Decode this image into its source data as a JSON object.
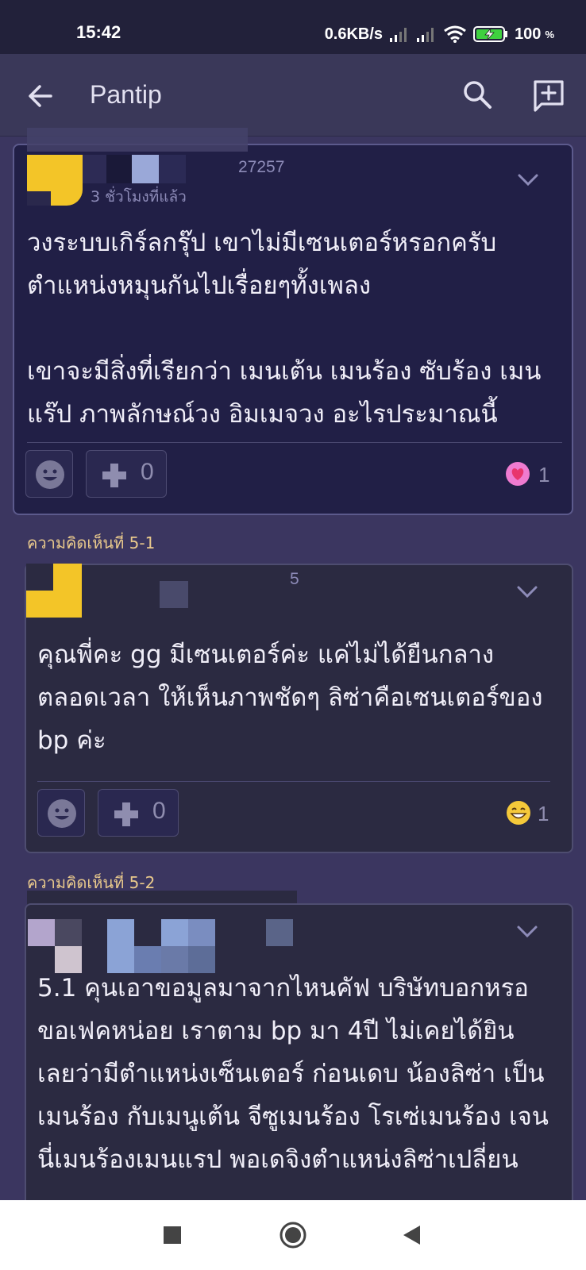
{
  "status_bar": {
    "time": "15:42",
    "network_speed": "0.6KB/s",
    "battery_percent": "100",
    "battery_unit": "%"
  },
  "app_bar": {
    "title": "Pantip",
    "icons": [
      "back-arrow-icon",
      "search-icon",
      "compose-icon"
    ]
  },
  "comments": [
    {
      "user_id_fragment": "27257",
      "time_ago": "3 ชั่วโมงที่แล้ว",
      "body": "วงระบบเกิร์ลกรุ๊ป เขาไม่มีเซนเตอร์หรอกครับ\nตำแหน่งหมุนกันไปเรื่อยๆทั้งเพลง\n\nเขาจะมีสิ่งที่เรียกว่า เมนเต้น เมนร้อง ซับร้อง เมน\nแร๊ป ภาพลักษณ์วง อิมเมจวง อะไรประมาณนี้",
      "plus_count": "0",
      "reaction_icon": "heart-face-icon",
      "reaction_count": "1"
    },
    {
      "label": "ความคิดเห็นที่ 5-1",
      "user_id_fragment": "5",
      "body": "คุณพี่คะ gg มีเซนเตอร์ค่ะ แค่ไม่ได้ยืนกลาง\nตลอดเวลา ให้เห็นภาพชัดๆ ลิซ่าคือเซนเตอร์ของ\nbp ค่ะ",
      "plus_count": "0",
      "reaction_icon": "grin-icon",
      "reaction_count": "1"
    },
    {
      "label": "ความคิดเห็นที่ 5-2",
      "body": "5.1 คุนเอาขอมูลมาจากไหนคัฟ บริษัทบอกหรอ\nขอเฟคหน่อย เราตาม bp มา 4ปี ไม่เคยได้ยิน\nเลยว่ามีตำแหน่งเซ็นเตอร์ ก่อนเดบ น้องลิซ่า เป็น\nเมนร้อง กับเมนูเต้น จีซูเมนร้อง โรเซ่เมนร้อง เจน\nนี่เมนร้องเมนแรป พอเดจิงตำแหน่งลิซ่าเปลี่ยน"
    }
  ],
  "nav_bar": {
    "icons": [
      "recents-square-icon",
      "home-circle-icon",
      "back-triangle-icon"
    ]
  }
}
